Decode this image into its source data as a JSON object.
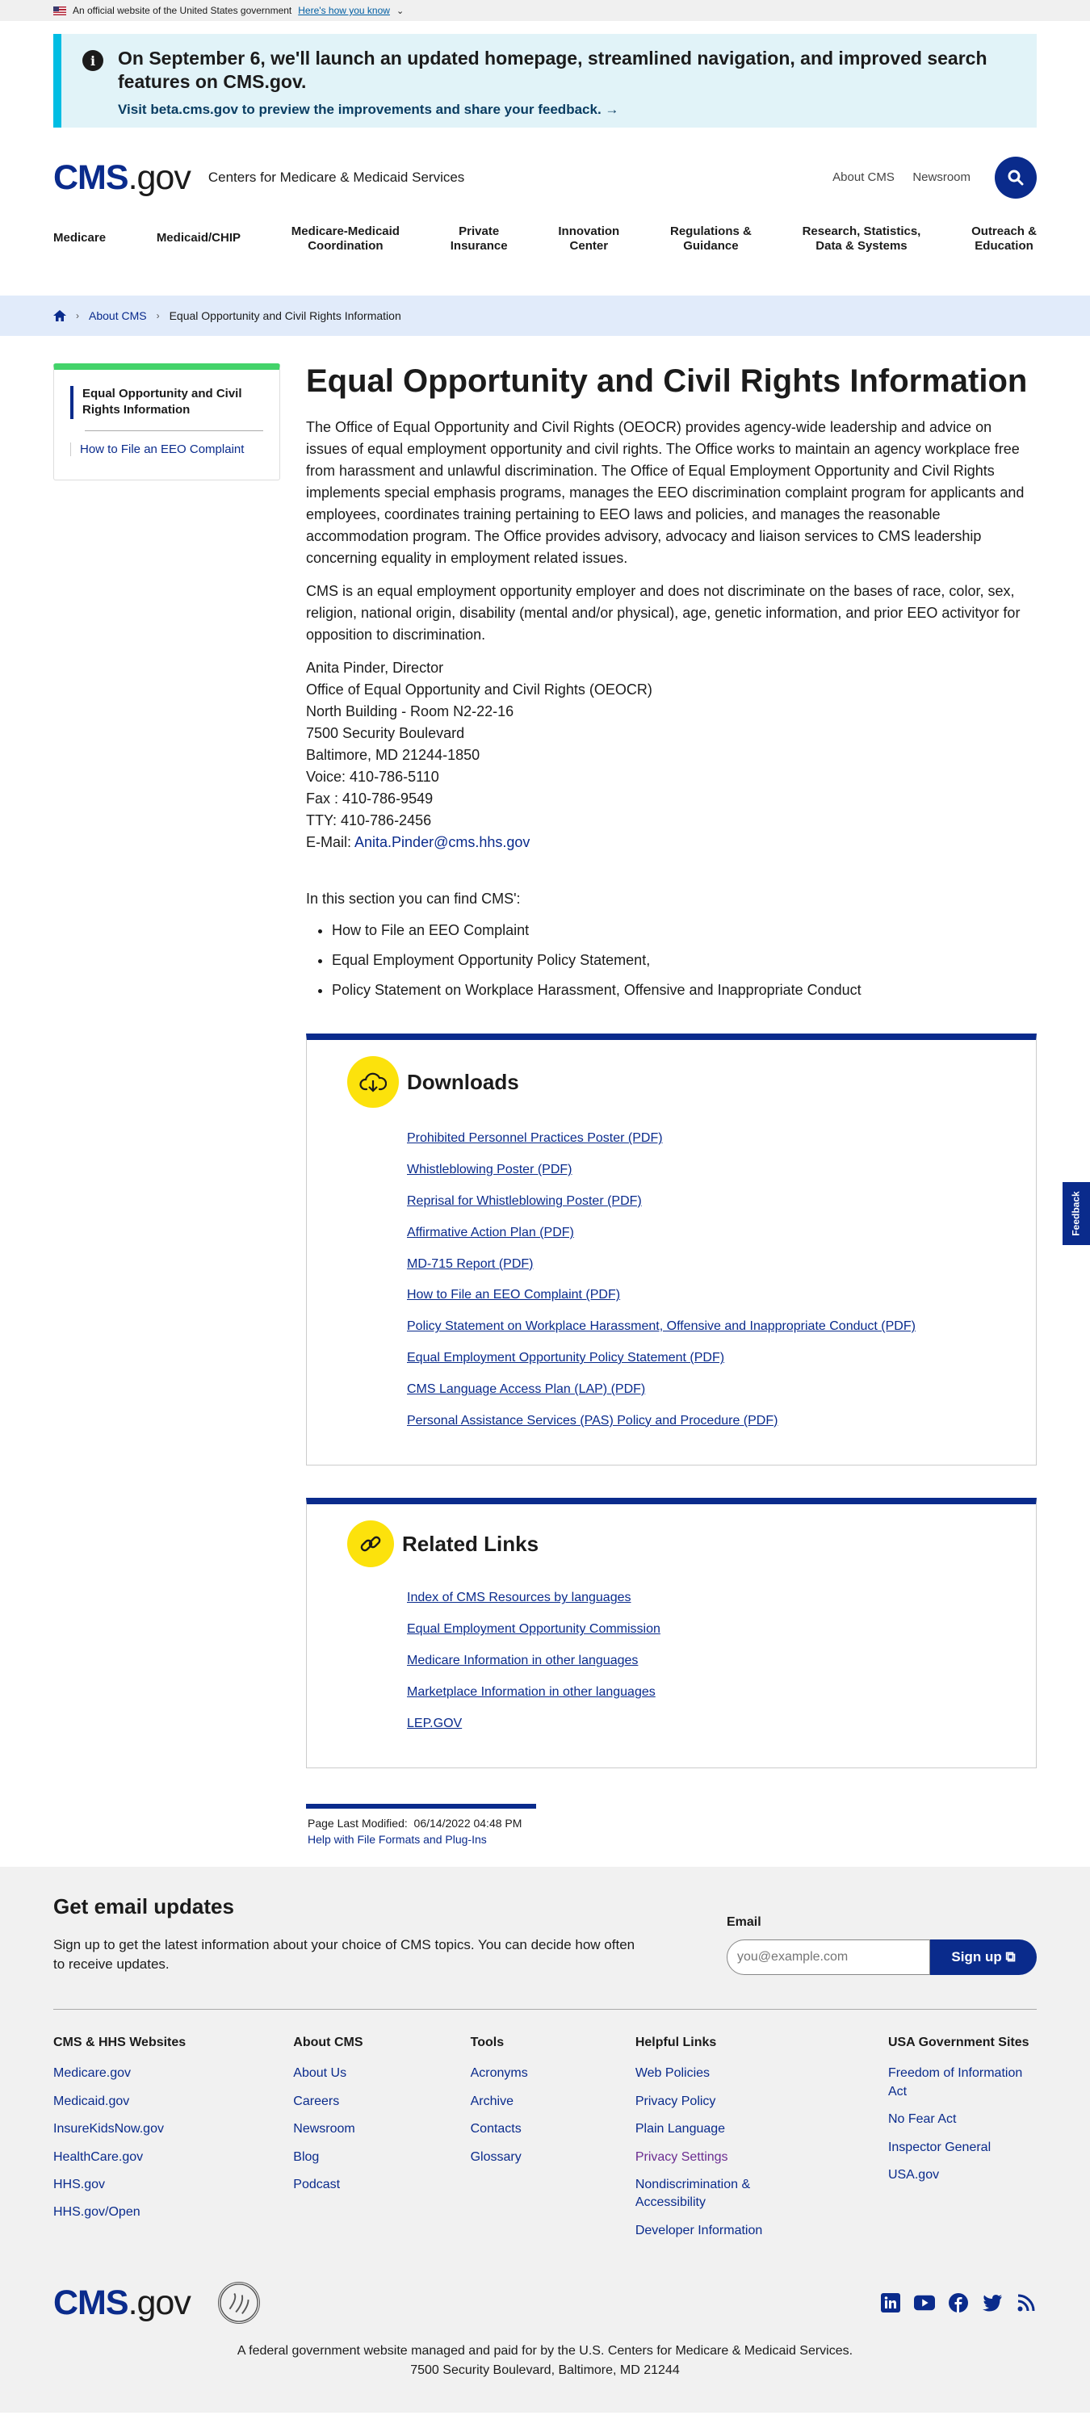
{
  "gov_banner": {
    "text": "An official website of the United States government",
    "link": "Here's how you know"
  },
  "alert": {
    "heading": "On September 6, we'll launch an updated homepage, streamlined navigation, and improved search features on CMS.gov.",
    "link": "Visit beta.cms.gov to preview the improvements and share your feedback."
  },
  "header": {
    "logo_cms": "CMS",
    "logo_gov": ".gov",
    "centers": "Centers for Medicare & Medicaid Services",
    "util_links": [
      "About CMS",
      "Newsroom"
    ]
  },
  "nav": [
    {
      "line1": "Medicare",
      "line2": ""
    },
    {
      "line1": "Medicaid/CHIP",
      "line2": ""
    },
    {
      "line1": "Medicare-Medicaid",
      "line2": "Coordination"
    },
    {
      "line1": "Private",
      "line2": "Insurance"
    },
    {
      "line1": "Innovation",
      "line2": "Center"
    },
    {
      "line1": "Regulations &",
      "line2": "Guidance"
    },
    {
      "line1": "Research, Statistics,",
      "line2": "Data & Systems"
    },
    {
      "line1": "Outreach &",
      "line2": "Education"
    }
  ],
  "breadcrumb": {
    "parent": "About CMS",
    "current": "Equal Opportunity and Civil Rights Information"
  },
  "sidenav": {
    "active": "Equal Opportunity and Civil Rights Information",
    "sub": "How to File an EEO Complaint"
  },
  "main": {
    "title": "Equal Opportunity and Civil Rights Information",
    "para1": "The Office of Equal Opportunity and Civil Rights (OEOCR) provides agency-wide leadership and advice on issues of equal employment opportunity and civil rights.  The Office works to maintain an agency workplace free from harassment and unlawful discrimination.  The Office of Equal Employment Opportunity and Civil Rights implements special emphasis programs, manages the EEO discrimination complaint program for applicants and employees, coordinates training pertaining to EEO laws and policies, and manages the reasonable accommodation program.  The Office provides advisory, advocacy and liaison services to CMS leadership concerning equality in employment related issues.",
    "para2": "CMS is an equal employment opportunity employer and does not discriminate on the bases of race, color, sex, religion, national origin, disability (mental and/or physical), age, genetic information, and prior EEO activityor for opposition to discrimination.",
    "address": [
      "Anita Pinder, Director",
      "Office of Equal Opportunity and Civil Rights (OEOCR)",
      "North Building - Room N2-22-16",
      "7500 Security Boulevard",
      "Baltimore, MD 21244-1850",
      "Voice: 410-786-5110",
      "Fax : 410-786-9549",
      "TTY: 410-786-2456"
    ],
    "email_label": "E-Mail: ",
    "email": "Anita.Pinder@cms.hhs.gov",
    "find_intro": "In this section you can find CMS':",
    "find_items": [
      "How to File an EEO Complaint",
      "Equal Employment Opportunity Policy Statement,",
      "Policy Statement on Workplace Harassment, Offensive and Inappropriate Conduct"
    ]
  },
  "downloads": {
    "title": "Downloads",
    "links": [
      "Prohibited Personnel Practices Poster (PDF)",
      "Whistleblowing Poster (PDF)",
      "Reprisal for Whistleblowing Poster (PDF)",
      "Affirmative Action Plan (PDF)",
      "MD-715 Report (PDF)",
      "How to File an EEO Complaint (PDF)",
      "Policy Statement on Workplace Harassment, Offensive and Inappropriate Conduct (PDF)",
      "Equal Employment Opportunity Policy Statement (PDF)",
      "CMS Language Access Plan (LAP) (PDF)",
      "Personal Assistance Services (PAS) Policy and Procedure (PDF)"
    ]
  },
  "related": {
    "title": "Related Links",
    "links": [
      "Index of CMS Resources by languages",
      "Equal Employment Opportunity Commission",
      "Medicare Information in other languages",
      "Marketplace Information in other languages",
      "LEP.GOV"
    ]
  },
  "modified": {
    "label": "Page Last Modified:",
    "value": "06/14/2022 04:48 PM",
    "help": "Help with File Formats and Plug-Ins"
  },
  "feedback": "Feedback",
  "footer": {
    "email_title": "Get email updates",
    "email_text": "Sign up to get the latest information about your choice of CMS topics. You can decide how often to receive updates.",
    "email_label": "Email",
    "email_placeholder": "you@example.com",
    "signup": "Sign up",
    "columns": [
      {
        "title": "CMS & HHS Websites",
        "links": [
          "Medicare.gov",
          "Medicaid.gov",
          "InsureKidsNow.gov",
          "HealthCare.gov",
          "HHS.gov",
          "HHS.gov/Open"
        ]
      },
      {
        "title": "About CMS",
        "links": [
          "About Us",
          "Careers",
          "Newsroom",
          "Blog",
          "Podcast"
        ]
      },
      {
        "title": "Tools",
        "links": [
          "Acronyms",
          "Archive",
          "Contacts",
          "Glossary"
        ]
      },
      {
        "title": "Helpful Links",
        "links": [
          "Web Policies",
          "Privacy Policy",
          "Plain Language",
          "Privacy Settings",
          "Nondiscrimination & Accessibility",
          "Developer Information"
        ]
      },
      {
        "title": "USA Government Sites",
        "links": [
          "Freedom of Information Act",
          "No Fear Act",
          "Inspector General",
          "USA.gov"
        ]
      }
    ],
    "note1": "A federal government website managed and paid for by the U.S. Centers for Medicare & Medicaid Services.",
    "note2": "7500 Security Boulevard, Baltimore, MD 21244"
  },
  "colors": {
    "brand": "#0a2b8c",
    "alert_bg": "#e1f3f8",
    "alert_bar": "#00bde3",
    "accent_yellow": "#fce20c",
    "sidenav_top": "#43d36a"
  },
  "icons": [
    "info-icon",
    "search-icon",
    "home-icon",
    "download-cloud-icon",
    "link-icon",
    "external-link-icon",
    "linkedin-icon",
    "youtube-icon",
    "facebook-icon",
    "twitter-icon",
    "rss-icon"
  ]
}
